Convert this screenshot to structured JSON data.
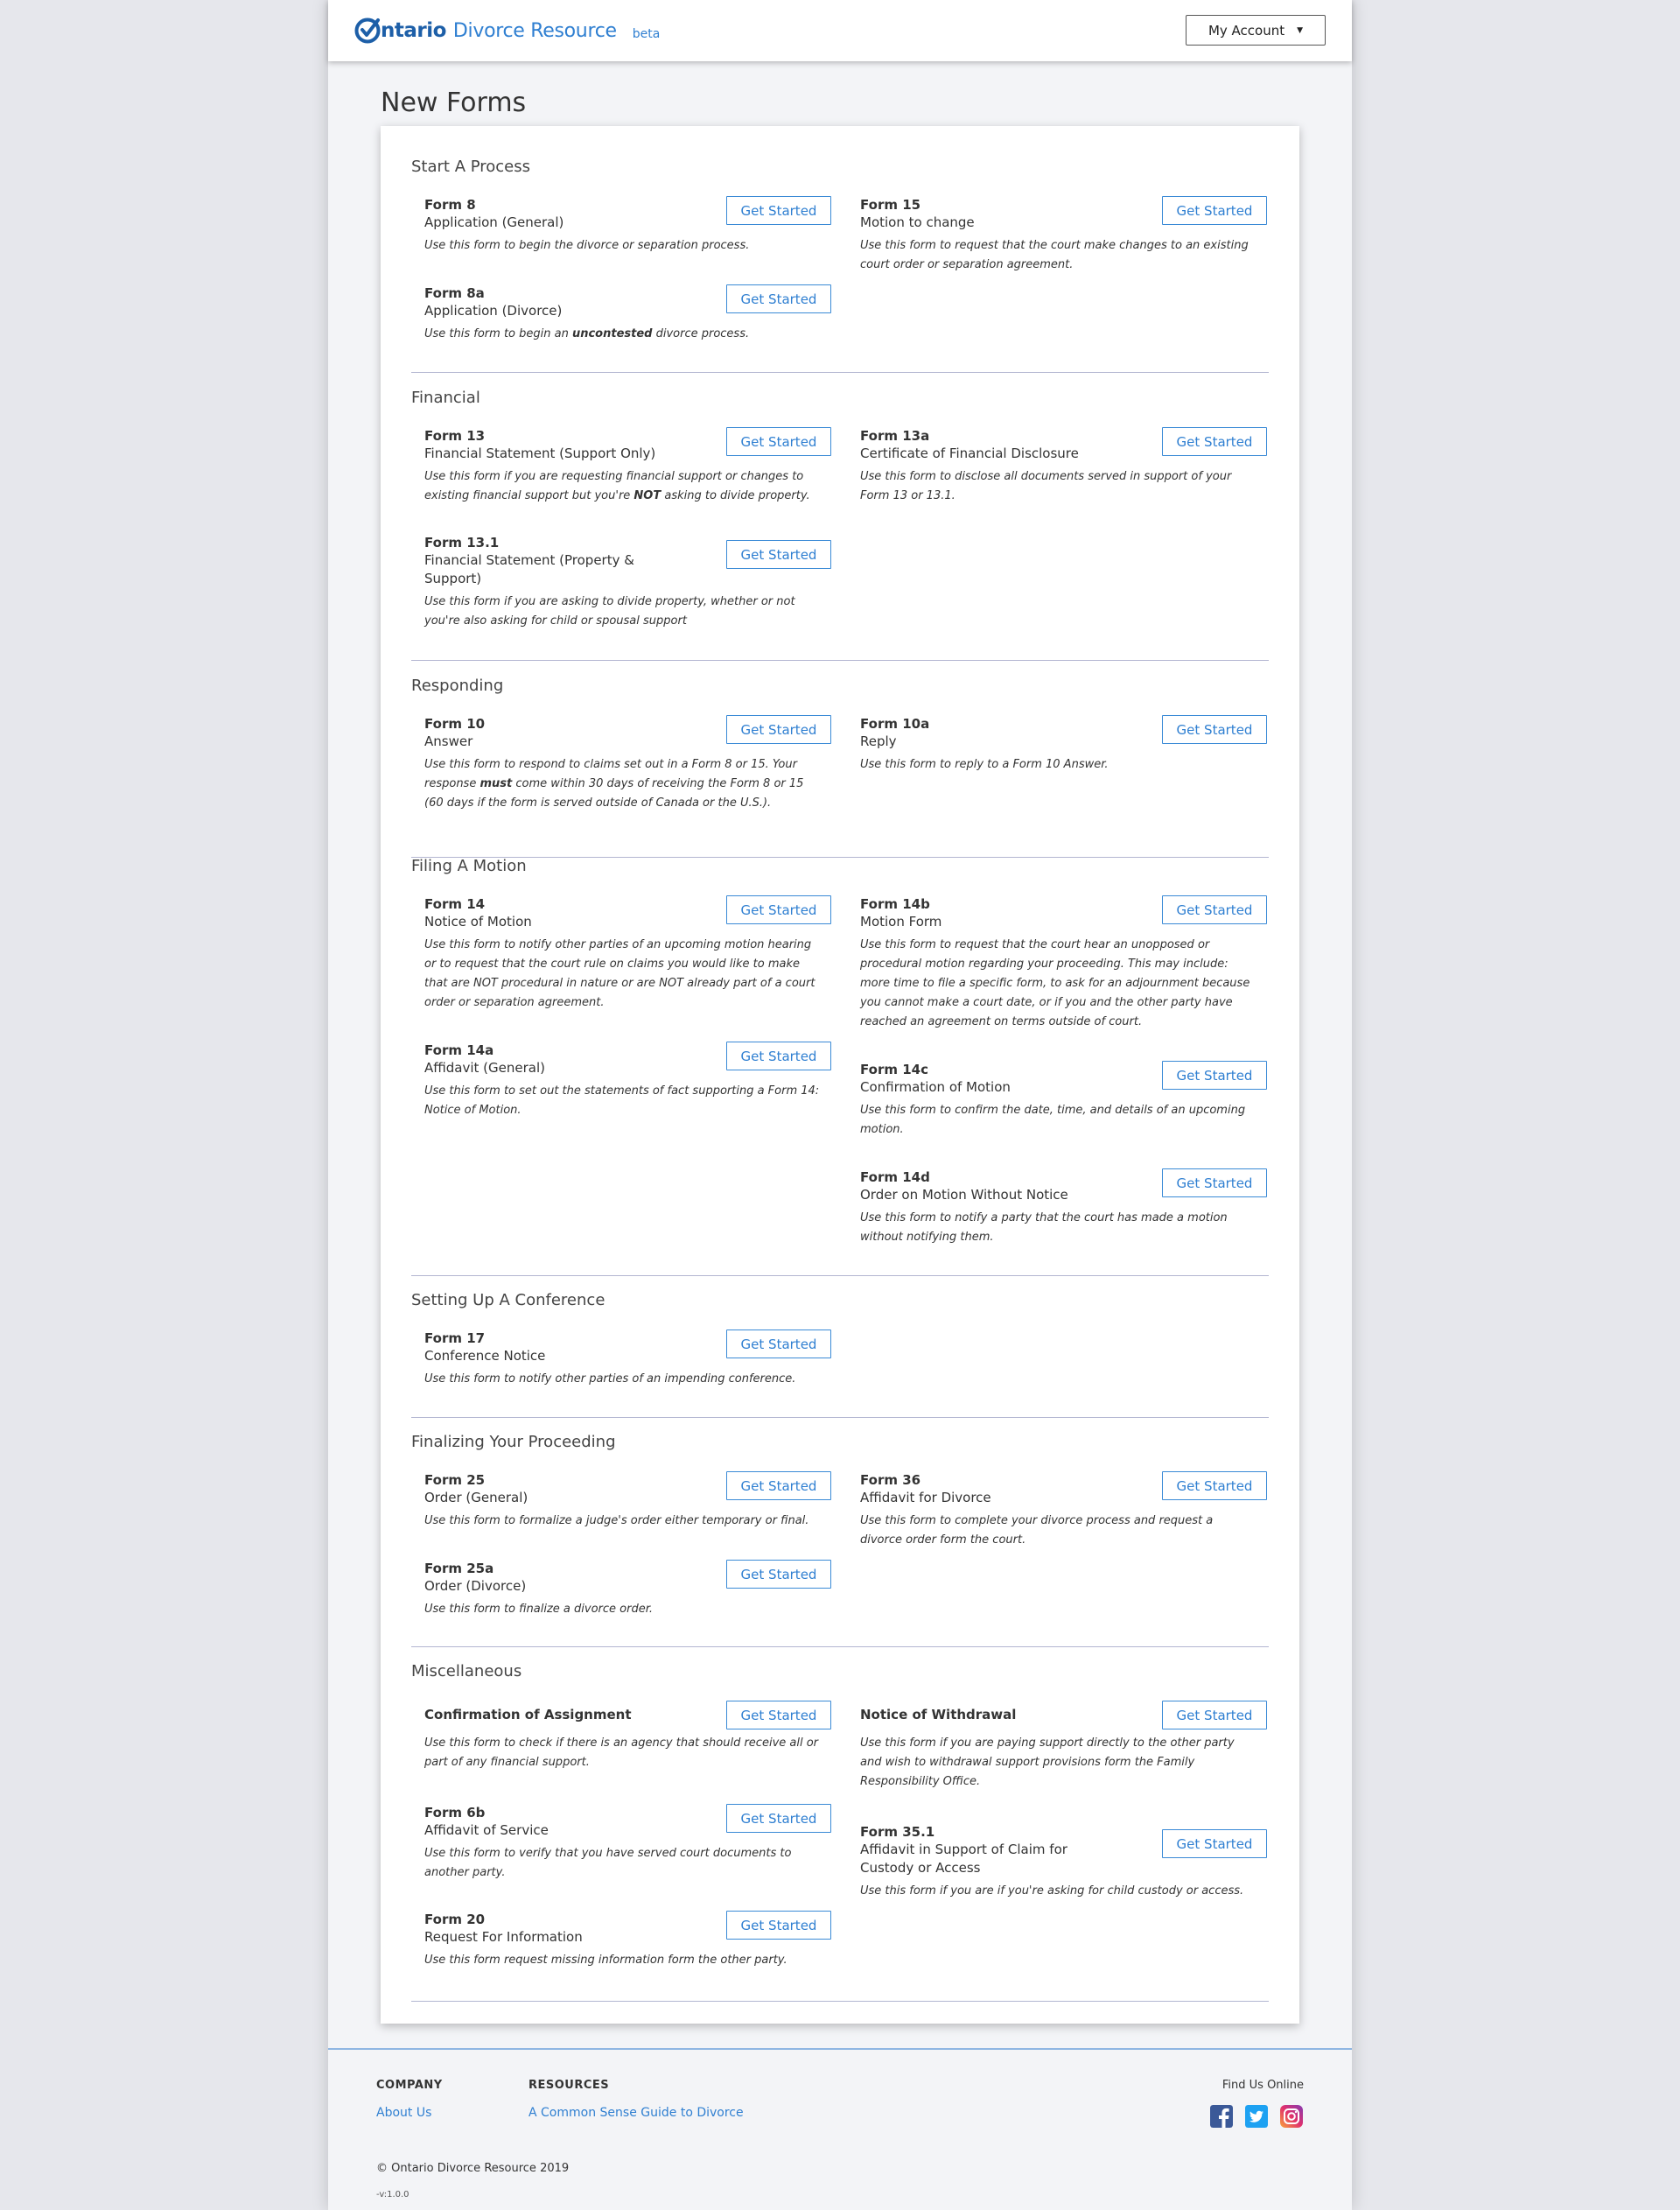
{
  "header": {
    "brand_strong": "ntario",
    "brand_light": "Divorce Resource",
    "beta": "beta",
    "account_label": "My Account"
  },
  "page_title": "New Forms",
  "get_started_label": "Get Started",
  "sections": {
    "start": {
      "title": "Start A Process",
      "form8": {
        "num": "Form 8",
        "name": "Application (General)",
        "desc": "Use this form to begin the divorce or separation process."
      },
      "form15": {
        "num": "Form 15",
        "name": "Motion to change",
        "desc": "Use this form to request that the court make changes to an existing court order or separation agreement."
      },
      "form8a": {
        "num": "Form 8a",
        "name": "Application (Divorce)",
        "desc_pre": "Use this form to begin an ",
        "desc_bold": "uncontested",
        "desc_post": " divorce process."
      }
    },
    "financial": {
      "title": "Financial",
      "form13": {
        "num": "Form 13",
        "name": "Financial Statement (Support Only)",
        "desc_pre": "Use this form if you are requesting financial support or changes to existing financial support but you're ",
        "desc_bold": "NOT",
        "desc_post": " asking to divide property."
      },
      "form13a": {
        "num": "Form 13a",
        "name": "Certificate of Financial Disclosure",
        "desc": "Use this form to disclose all documents served in support of your Form 13 or 13.1."
      },
      "form13_1": {
        "num": "Form 13.1",
        "name": "Financial Statement (Property & Support)",
        "desc": "Use this form if you are asking to divide property, whether or not you're also asking for child or spousal support"
      }
    },
    "responding": {
      "title": "Responding",
      "form10": {
        "num": "Form 10",
        "name": "Answer",
        "desc_pre": "Use this form to respond to claims set out in a Form 8 or 15. Your response ",
        "desc_bold": "must",
        "desc_post": " come within 30 days of receiving the Form 8 or 15 (60 days if the form is served outside of Canada or the U.S.)."
      },
      "form10a": {
        "num": "Form 10a",
        "name": "Reply",
        "desc": "Use this form to reply to a Form 10 Answer."
      }
    },
    "motion": {
      "title": "Filing A Motion",
      "form14": {
        "num": "Form 14",
        "name": "Notice of Motion",
        "desc": "Use this form to notify other parties of an upcoming motion hearing or to request that the court rule on claims you would like to make that are NOT procedural in nature or are NOT already part of a court order or separation agreement."
      },
      "form14b": {
        "num": "Form 14b",
        "name": "Motion Form",
        "desc": "Use this form to request that the court hear an unopposed or procedural motion regarding your proceeding. This may include: more time to file a specific form, to ask for an adjournment because you cannot make a court date, or if you and the other party have reached an agreement on terms outside of court."
      },
      "form14a": {
        "num": "Form 14a",
        "name": "Affidavit (General)",
        "desc": "Use this form to set out the statements of fact supporting a Form 14: Notice of Motion."
      },
      "form14c": {
        "num": "Form 14c",
        "name": "Confirmation of Motion",
        "desc": "Use this form to confirm the date, time, and details of an upcoming motion."
      },
      "form14d": {
        "num": "Form 14d",
        "name": "Order on Motion Without Notice",
        "desc": "Use this form to notify a party that the court has made a motion without notifying them."
      }
    },
    "conference": {
      "title": "Setting Up A Conference",
      "form17": {
        "num": "Form 17",
        "name": "Conference Notice",
        "desc": "Use this form to notify other parties of an impending conference."
      }
    },
    "finalizing": {
      "title": "Finalizing Your Proceeding",
      "form25": {
        "num": "Form 25",
        "name": "Order (General)",
        "desc": "Use this form to formalize a judge's order either temporary or final."
      },
      "form36": {
        "num": "Form 36",
        "name": "Affidavit for Divorce",
        "desc": "Use this form to complete your divorce process and request a divorce order form the court."
      },
      "form25a": {
        "num": "Form 25a",
        "name": "Order (Divorce)",
        "desc": "Use this form to finalize a divorce order."
      }
    },
    "misc": {
      "title": "Miscellaneous",
      "assignment": {
        "num": "Confirmation of Assignment",
        "desc": "Use this form to check if there is an agency that should receive all or part of any financial support."
      },
      "withdrawal": {
        "num": "Notice of Withdrawal",
        "desc": "Use this form if you are paying support directly to the other party and wish to withdrawal support provisions form the Family Responsibility Office."
      },
      "form6b": {
        "num": "Form 6b",
        "name": "Affidavit of Service",
        "desc": "Use this form to verify that you have served court documents to another party."
      },
      "form35_1": {
        "num": "Form 35.1",
        "name": "Affidavit in Support of Claim for Custody or Access",
        "desc": "Use this form if you are if you're asking for child custody or access."
      },
      "form20": {
        "num": "Form 20",
        "name": "Request For Information",
        "desc": "Use this form request missing information form the other party."
      }
    }
  },
  "footer": {
    "company_head": "COMPANY",
    "about_link": "About Us",
    "resources_head": "RESOURCES",
    "guide_link": "A Common Sense Guide to Divorce",
    "find_us": "Find Us Online",
    "copyright": "© Ontario Divorce Resource 2019",
    "version": "-v:1.0.0"
  },
  "colors": {
    "brand": "#2f7fd1",
    "facebook": "#3b5998",
    "twitter": "#1da1f2",
    "instagram": "#c13584"
  },
  "icons": [
    "ontario-check-logo-icon",
    "caret-down-icon",
    "facebook-icon",
    "twitter-icon",
    "instagram-icon"
  ]
}
